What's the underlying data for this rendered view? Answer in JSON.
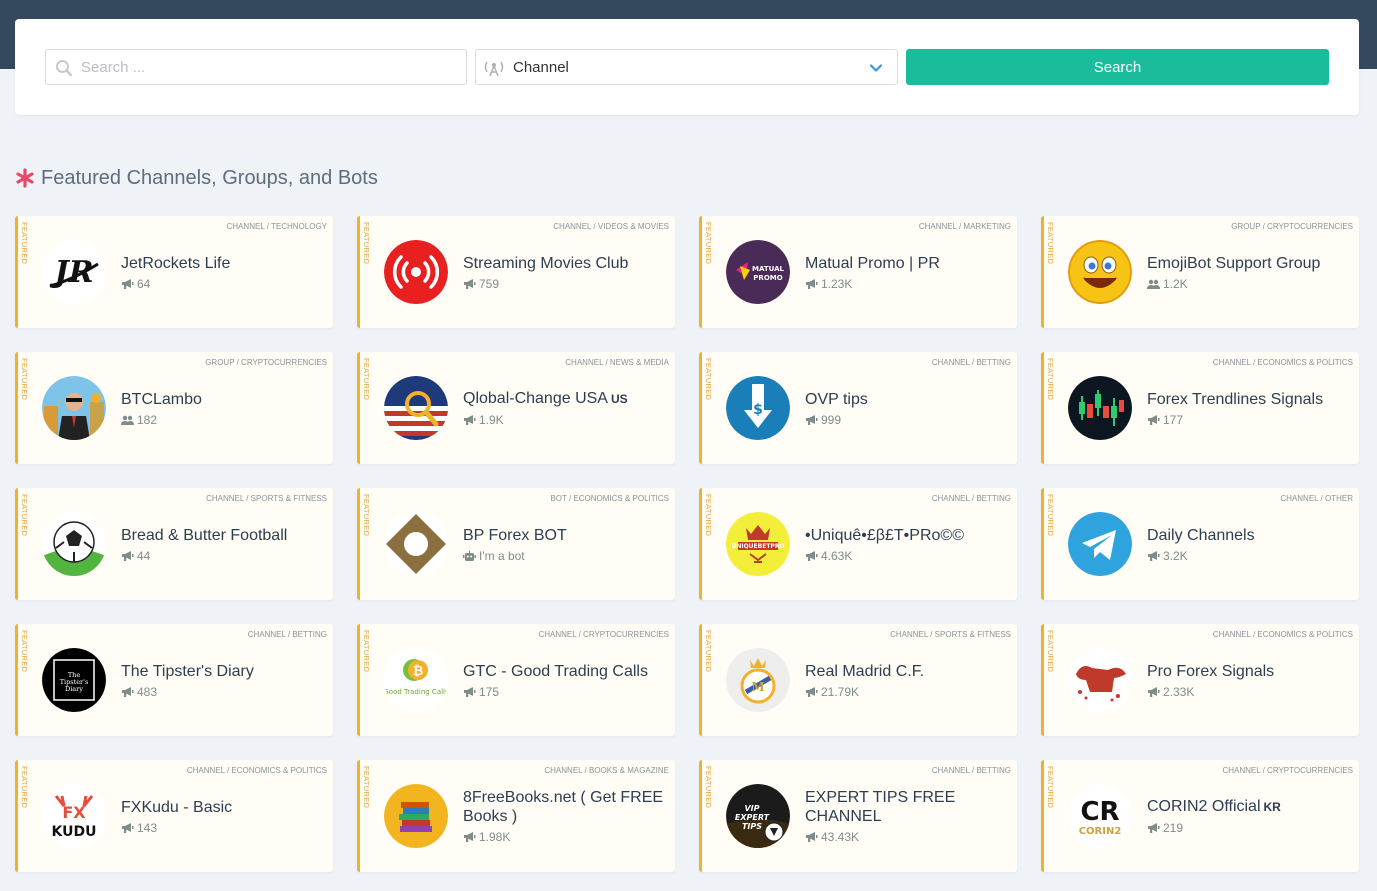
{
  "search": {
    "placeholder": "Search ...",
    "type_value": "Channel",
    "button_label": "Search"
  },
  "section": {
    "title": "Featured Channels, Groups, and Bots",
    "featured_label": "FEATURED"
  },
  "colors": {
    "accent": "#1abc9c",
    "topbar": "#34495e",
    "featured": "#f3b02a",
    "star": "#e8496a"
  },
  "cards": [
    {
      "category": "CHANNEL / TECHNOLOGY",
      "name": "JetRockets Life",
      "cc": "",
      "count": "64",
      "kind": "channel",
      "icon": "jetrockets-logo"
    },
    {
      "category": "CHANNEL / VIDEOS & MOVIES",
      "name": "Streaming Movies Club",
      "cc": "",
      "count": "759",
      "kind": "channel",
      "icon": "broadcast-icon"
    },
    {
      "category": "CHANNEL / MARKETING",
      "name": "Matual Promo | PR",
      "cc": "",
      "count": "1.23K",
      "kind": "channel",
      "icon": "matual-promo-logo"
    },
    {
      "category": "GROUP / CRYPTOCURRENCIES",
      "name": "EmojiBot Support Group",
      "cc": "",
      "count": "1.2K",
      "kind": "group",
      "icon": "emoji-face"
    },
    {
      "category": "GROUP / CRYPTOCURRENCIES",
      "name": "BTCLambo",
      "cc": "",
      "count": "182",
      "kind": "group",
      "icon": "businessman-avatar"
    },
    {
      "category": "CHANNEL / NEWS & MEDIA",
      "name": "Qlobal-Change USA",
      "cc": "US",
      "count": "1.9K",
      "kind": "channel",
      "icon": "usa-flag-magnifier"
    },
    {
      "category": "CHANNEL / BETTING",
      "name": "OVP tips",
      "cc": "",
      "count": "999",
      "kind": "channel",
      "icon": "dollar-arrow"
    },
    {
      "category": "CHANNEL / ECONOMICS & POLITICS",
      "name": "Forex Trendlines Signals",
      "cc": "",
      "count": "177",
      "kind": "channel",
      "icon": "candlestick-chart"
    },
    {
      "category": "CHANNEL / SPORTS & FITNESS",
      "name": "Bread & Butter Football",
      "cc": "",
      "count": "44",
      "kind": "channel",
      "icon": "football"
    },
    {
      "category": "BOT / ECONOMICS & POLITICS",
      "name": "BP Forex BOT",
      "cc": "",
      "count": "I'm a bot",
      "kind": "bot",
      "icon": "diamond-logo"
    },
    {
      "category": "CHANNEL / BETTING",
      "name": "•Uniquê•£β£T•PRo©©",
      "cc": "",
      "count": "4.63K",
      "kind": "channel",
      "icon": "crown-logo"
    },
    {
      "category": "CHANNEL / OTHER",
      "name": "Daily Channels",
      "cc": "",
      "count": "3.2K",
      "kind": "channel",
      "icon": "telegram-plane"
    },
    {
      "category": "CHANNEL / BETTING",
      "name": "The Tipster's Diary",
      "cc": "",
      "count": "483",
      "kind": "channel",
      "icon": "tipsters-diary-logo",
      "logo_text": "The Tipster's Diary"
    },
    {
      "category": "CHANNEL / CRYPTOCURRENCIES",
      "name": "GTC - Good Trading Calls",
      "cc": "",
      "count": "175",
      "kind": "channel",
      "icon": "bitcoin-logo",
      "logo_text": "Good Trading Calls"
    },
    {
      "category": "CHANNEL / SPORTS & FITNESS",
      "name": "Real Madrid C.F.",
      "cc": "",
      "count": "21.79K",
      "kind": "channel",
      "icon": "real-madrid-crest"
    },
    {
      "category": "CHANNEL / ECONOMICS & POLITICS",
      "name": "Pro Forex Signals",
      "cc": "",
      "count": "2.33K",
      "kind": "channel",
      "icon": "bull-logo"
    },
    {
      "category": "CHANNEL / ECONOMICS & POLITICS",
      "name": "FXKudu - Basic",
      "cc": "",
      "count": "143",
      "kind": "channel",
      "icon": "fxkudu-logo",
      "logo_text": "KUDU"
    },
    {
      "category": "CHANNEL / BOOKS & MAGAZINE",
      "name": "8FreeBooks.net ( Get FREE Books )",
      "cc": "",
      "count": "1.98K",
      "kind": "channel",
      "icon": "books-stack"
    },
    {
      "category": "CHANNEL / BETTING",
      "name": "EXPERT TIPS FREE CHANNEL",
      "cc": "",
      "count": "43.43K",
      "kind": "channel",
      "icon": "expert-tips-logo",
      "logo_text": "VIP EXPERT TIPS"
    },
    {
      "category": "CHANNEL / CRYPTOCURRENCIES",
      "name": "CORIN2 Official",
      "cc": "KR",
      "count": "219",
      "kind": "channel",
      "icon": "corin2-logo",
      "logo_text": "CORIN2"
    }
  ]
}
